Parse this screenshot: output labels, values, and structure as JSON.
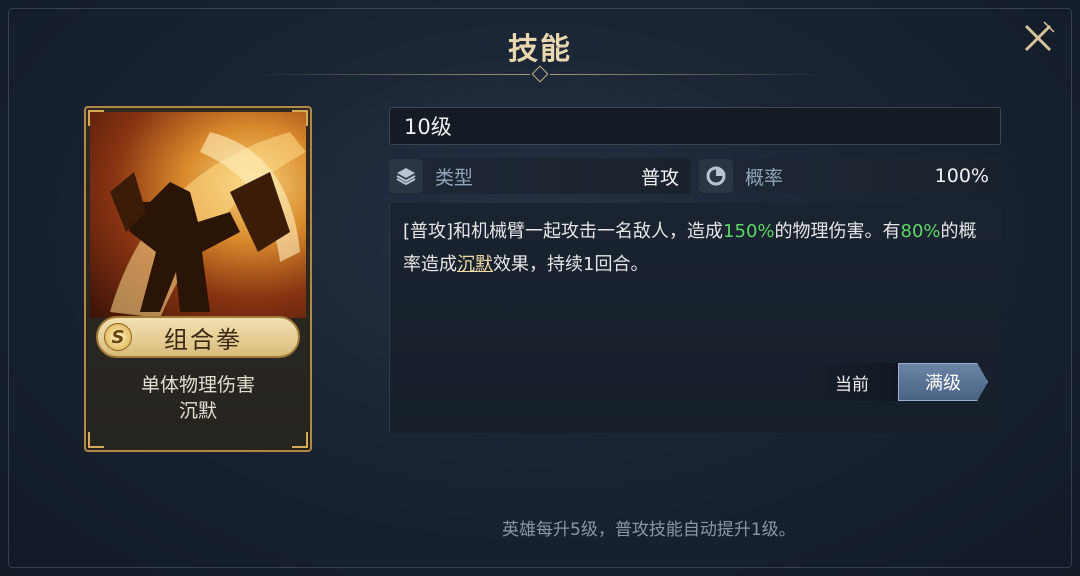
{
  "header": {
    "title": "技能"
  },
  "card": {
    "badge": "S",
    "skill_name": "组合拳",
    "tags": [
      "单体物理伤害",
      "沉默"
    ]
  },
  "level": "10级",
  "stats": {
    "type_label": "类型",
    "type_value": "普攻",
    "rate_label": "概率",
    "rate_value": "100%"
  },
  "description": {
    "part1": "[普攻]和机械臂一起攻击一名敌人，造成",
    "highlight1": "150%",
    "part2": "的物理伤害。有",
    "highlight2": "80%",
    "part3": "的概率造成",
    "keyword": "沉默",
    "part4": "效果，持续1回合。"
  },
  "toggle": {
    "current": "当前",
    "max": "满级"
  },
  "footer": "英雄每升5级，普攻技能自动提升1级。",
  "colors": {
    "highlight": "#5fd66a",
    "title": "#e9d8ae",
    "card_border": "#b08a45"
  }
}
